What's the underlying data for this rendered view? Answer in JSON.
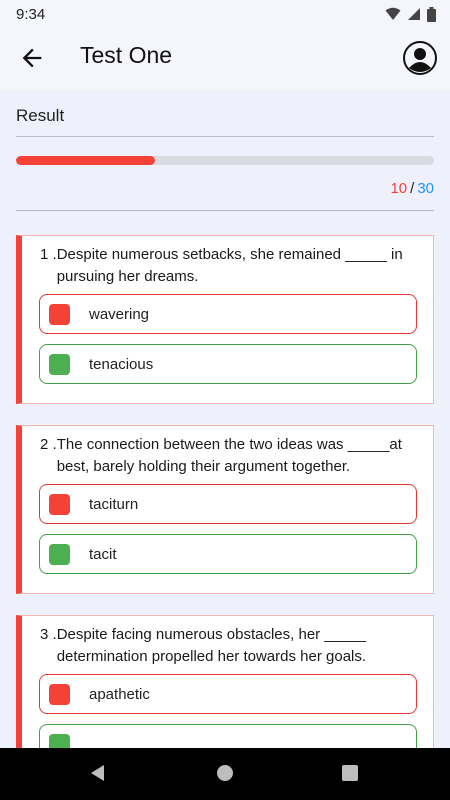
{
  "status_bar": {
    "time": "9:34"
  },
  "app_bar": {
    "title": "Test One"
  },
  "result": {
    "label": "Result",
    "score": 10,
    "total": 30,
    "progress_fraction": 0.333,
    "sep": "/"
  },
  "questions": [
    {
      "number": "1 .",
      "text": "Despite numerous setbacks, she remained _____ in pursuing her dreams.",
      "selected": "wavering",
      "correct": "tenacious"
    },
    {
      "number": "2 .",
      "text": "The connection between the two ideas was _____at best, barely holding their argument together.",
      "selected": "taciturn",
      "correct": "tacit"
    },
    {
      "number": "3 .",
      "text": "Despite facing numerous obstacles, her _____ determination propelled her towards her goals.",
      "selected": "apathetic",
      "correct": ""
    }
  ],
  "colors": {
    "wrong": "#f44336",
    "right": "#4caf50",
    "score_total": "#2196f3"
  }
}
